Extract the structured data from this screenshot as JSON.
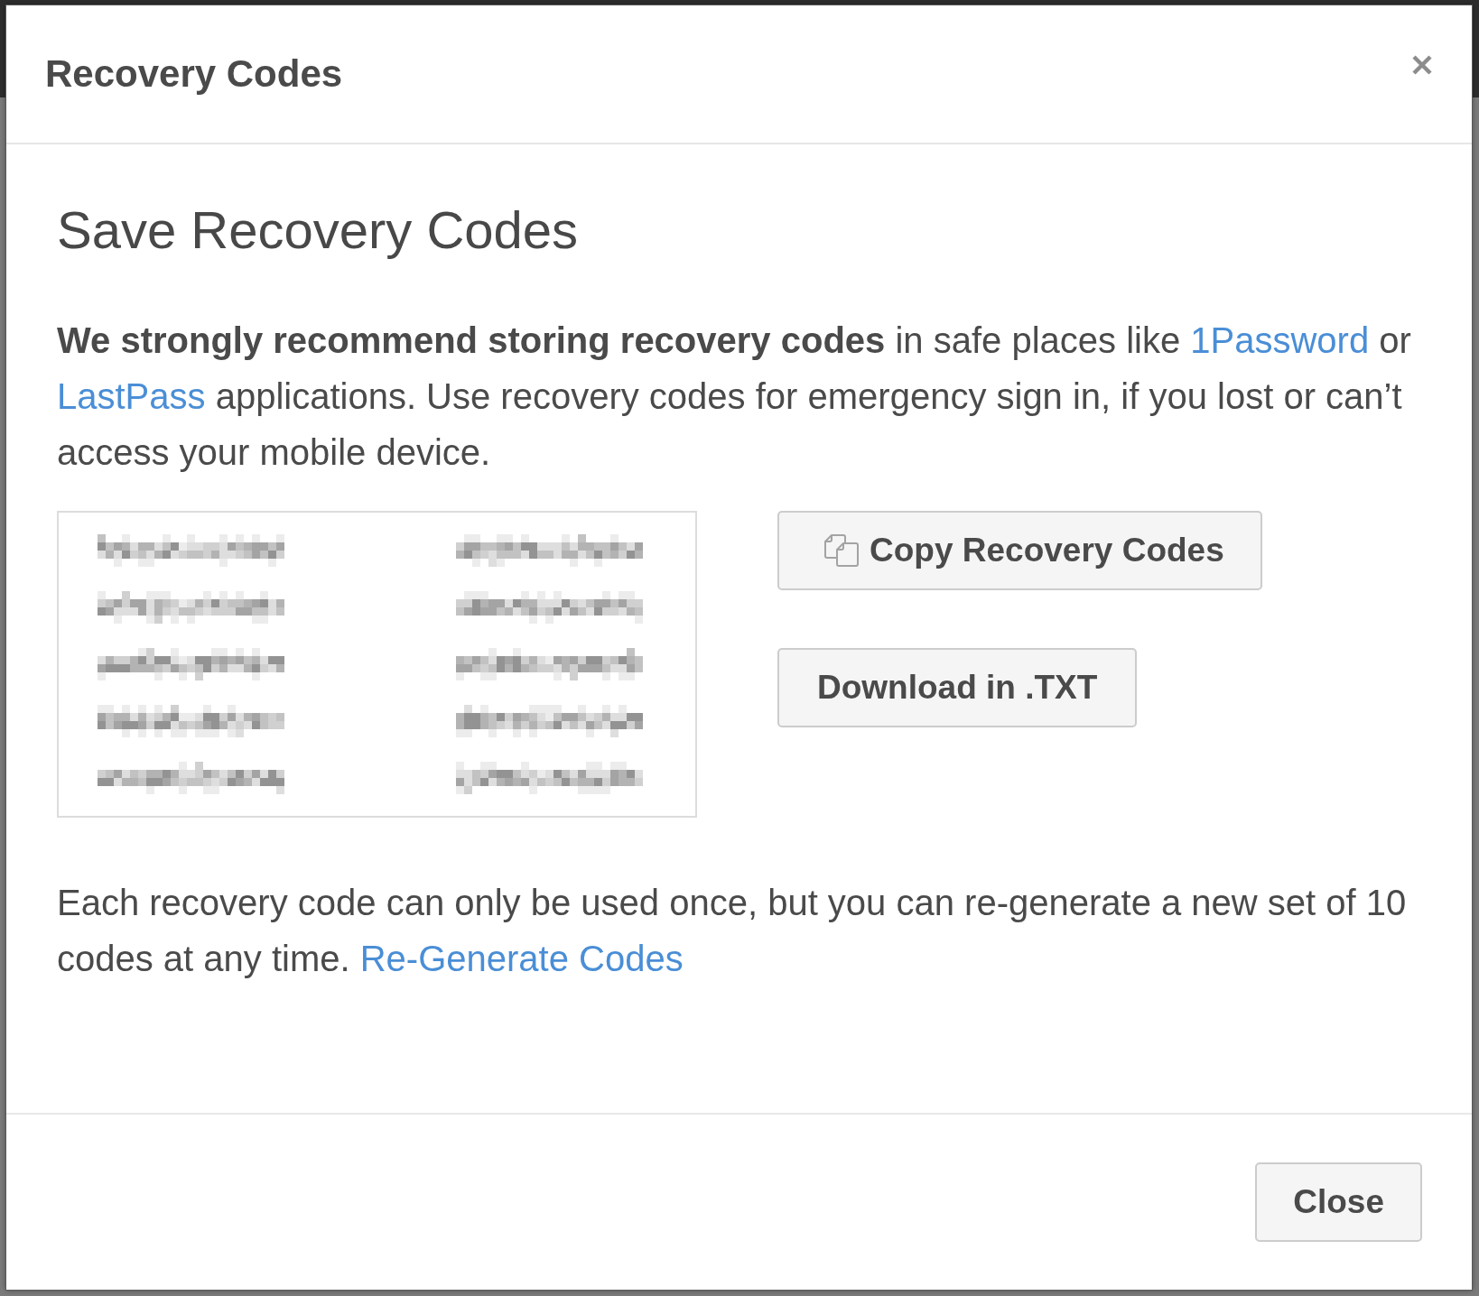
{
  "dialog": {
    "title": "Recovery Codes"
  },
  "content": {
    "heading": "Save Recovery Codes",
    "intro": [
      {
        "kind": "text",
        "text": "**We strongly recommend storing recovery codes** in safe places like "
      },
      {
        "kind": "link",
        "text": "1Password"
      },
      {
        "kind": "text",
        "text": " or "
      },
      {
        "kind": "link",
        "text": "LastPass"
      },
      {
        "kind": "text",
        "text": " applications. Use recovery codes for emergency sign in, if you lost or can’t access your mobile device."
      }
    ],
    "codes": [
      {
        "kind": "pixelated"
      },
      {
        "kind": "pixelated"
      },
      {
        "kind": "pixelated"
      },
      {
        "kind": "pixelated"
      },
      {
        "kind": "pixelated"
      },
      {
        "kind": "pixelated"
      },
      {
        "kind": "pixelated"
      },
      {
        "kind": "pixelated"
      },
      {
        "kind": "pixelated"
      },
      {
        "kind": "pixelated"
      }
    ],
    "actions": [
      {
        "kind": "copy",
        "label": "Copy Recovery Codes"
      },
      {
        "kind": "download",
        "label": "Download in .TXT"
      }
    ],
    "note": [
      {
        "kind": "text",
        "text": "Each recovery code can only be used once, but you can re-generate a new set of 10 codes at any time. "
      },
      {
        "kind": "link",
        "text": "Re-Generate Codes"
      }
    ]
  },
  "footer": {
    "buttons": [
      {
        "label": "Close"
      }
    ]
  }
}
